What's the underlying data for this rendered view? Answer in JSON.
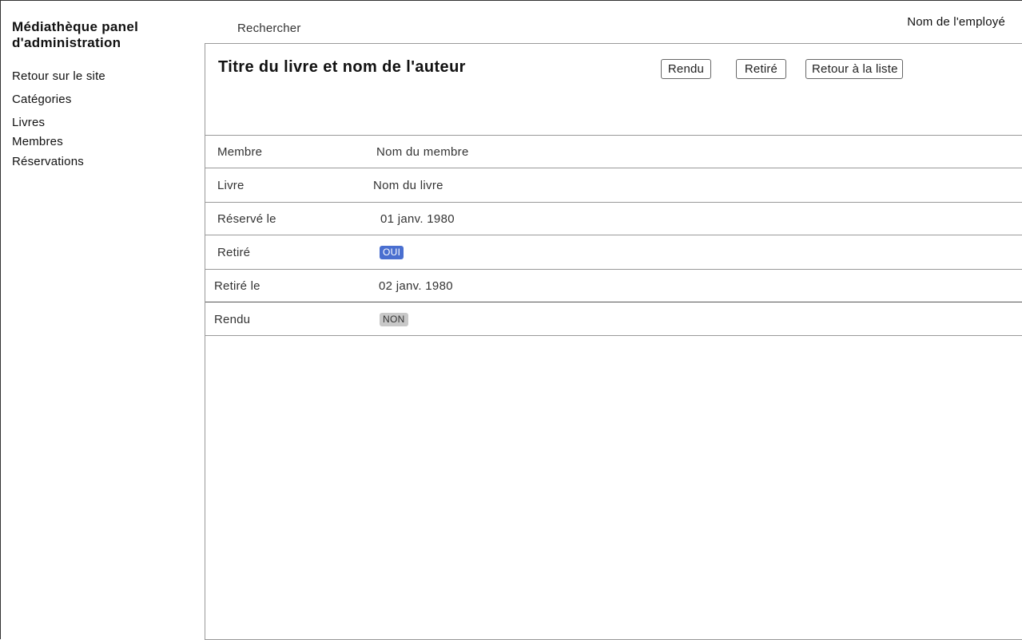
{
  "brand": {
    "title": "Médiathèque panel d'administration"
  },
  "sidebar": {
    "items": [
      {
        "label": "Retour sur le site"
      },
      {
        "label": "Catégories"
      },
      {
        "label": "Livres"
      },
      {
        "label": "Membres"
      },
      {
        "label": "Réservations"
      }
    ]
  },
  "header": {
    "search_label": "Rechercher",
    "user_name": "Nom de l'employé"
  },
  "main": {
    "title": "Titre du livre et nom de l'auteur",
    "actions": {
      "rendu_label": "Rendu",
      "retire_label": "Retiré",
      "back_label": "Retour à la liste"
    },
    "rows": [
      {
        "label": "Membre",
        "value": "Nom du membre"
      },
      {
        "label": "Livre",
        "value": "Nom du livre"
      },
      {
        "label": "Réservé le",
        "value": "01 janv. 1980"
      },
      {
        "label": "Retiré",
        "value": "OUI"
      },
      {
        "label": "Retiré le",
        "value": "02 janv. 1980"
      },
      {
        "label": "Rendu",
        "value": "NON"
      }
    ]
  },
  "colors": {
    "badge_yes_bg": "#4a6fd0",
    "badge_yes_text": "#ffffff",
    "badge_no_bg": "#c8c8c8",
    "badge_no_text": "#333333"
  }
}
